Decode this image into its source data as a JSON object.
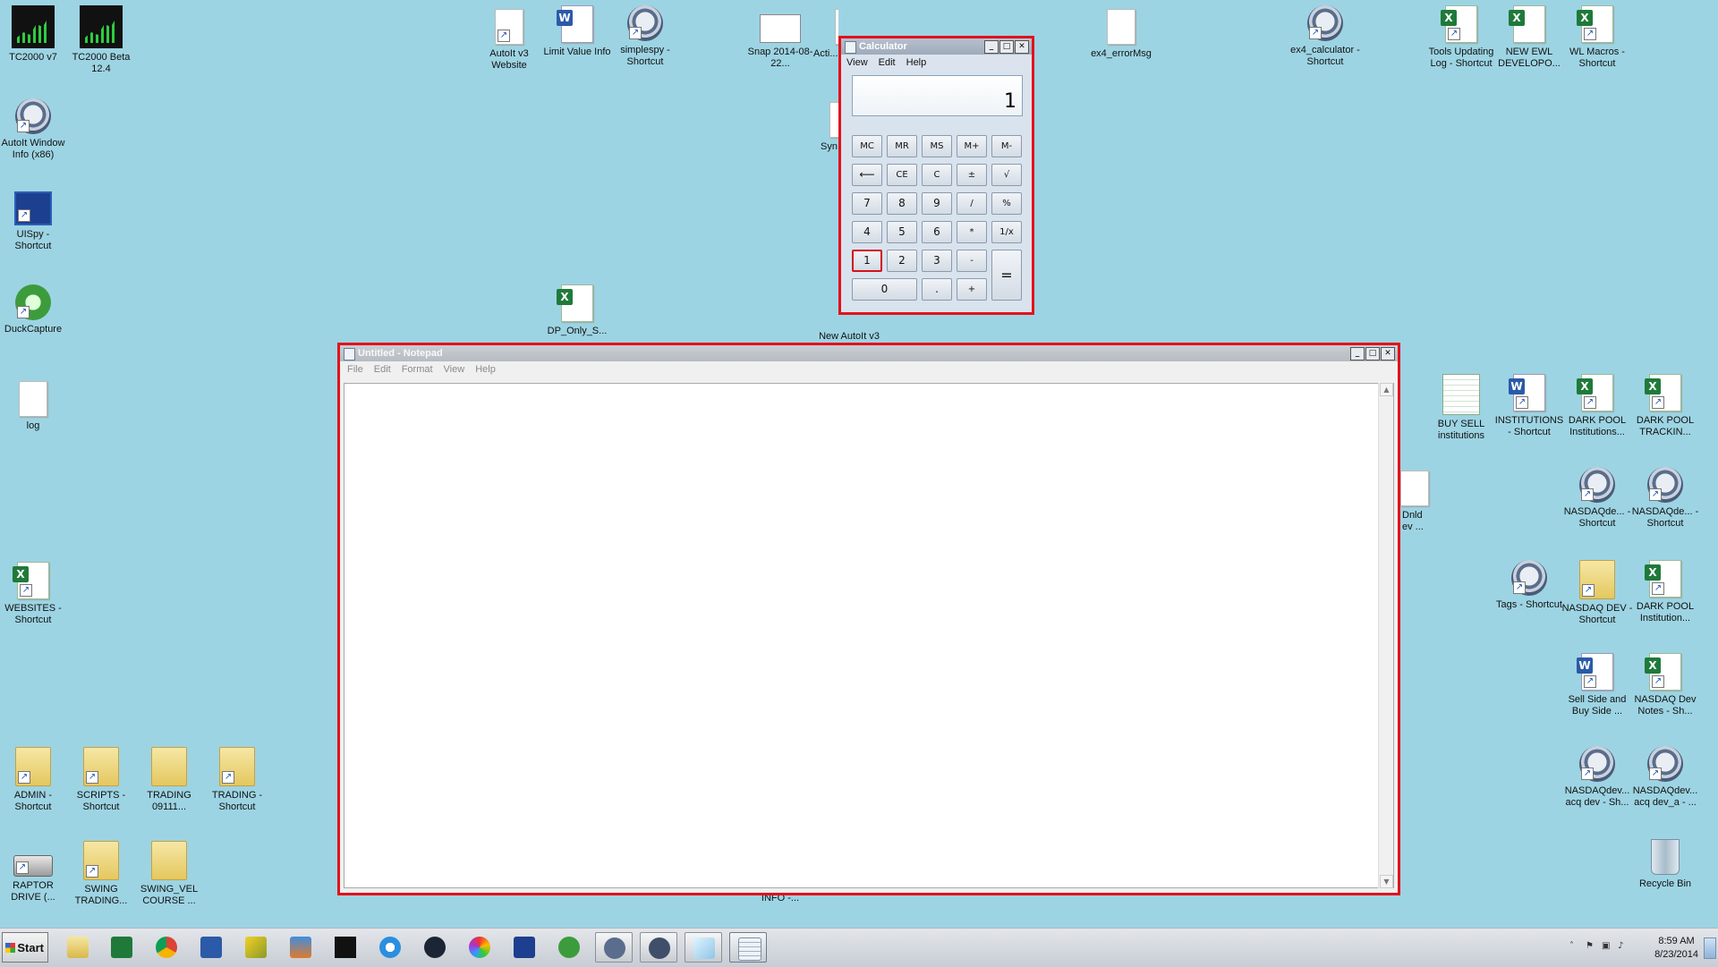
{
  "desktop": {
    "icons": [
      {
        "label": "TC2000 v7"
      },
      {
        "label": "TC2000 Beta 12.4"
      },
      {
        "label": "AutoIt Window Info (x86)"
      },
      {
        "label": "UISpy - Shortcut"
      },
      {
        "label": "DuckCapture"
      },
      {
        "label": "log"
      },
      {
        "label": "WEBSITES - Shortcut"
      },
      {
        "label": "ADMIN - Shortcut"
      },
      {
        "label": "SCRIPTS - Shortcut"
      },
      {
        "label": "TRADING 09111..."
      },
      {
        "label": "TRADING - Shortcut"
      },
      {
        "label": "RAPTOR DRIVE (..."
      },
      {
        "label": "SWING TRADING..."
      },
      {
        "label": "SWING_VEL COURSE ..."
      },
      {
        "label": "AutoIt v3 Website"
      },
      {
        "label": "Limit Value Info"
      },
      {
        "label": "simplespy - Shortcut"
      },
      {
        "label": "Snap 2014-08-22..."
      },
      {
        "label": "Acti..."
      },
      {
        "label": "Syn..."
      },
      {
        "label": "DP_Only_S..."
      },
      {
        "label": "New AutoIt v3"
      },
      {
        "label": "ex4_errorMsg"
      },
      {
        "label": "ex4_calculator - Shortcut"
      },
      {
        "label": "Tools Updating Log - Shortcut"
      },
      {
        "label": "NEW EWL DEVELOPO..."
      },
      {
        "label": "WL Macros - Shortcut"
      },
      {
        "label": "BUY SELL institutions"
      },
      {
        "label": "INSTITUTIONS - Shortcut"
      },
      {
        "label": "DARK POOL Institutions..."
      },
      {
        "label": "DARK POOL TRACKIN..."
      },
      {
        "label": "Dnld ev ..."
      },
      {
        "label": "NASDAQde... - Shortcut"
      },
      {
        "label": "NASDAQde... - Shortcut"
      },
      {
        "label": "Tags - Shortcut"
      },
      {
        "label": "NASDAQ DEV - Shortcut"
      },
      {
        "label": "DARK POOL Institution..."
      },
      {
        "label": "Sell Side and Buy Side ..."
      },
      {
        "label": "NASDAQ Dev Notes - Sh..."
      },
      {
        "label": "NASDAQdev... acq dev - Sh..."
      },
      {
        "label": "NASDAQdev... acq dev_a - ..."
      },
      {
        "label": "Recycle Bin"
      },
      {
        "label": "INFO -..."
      }
    ]
  },
  "calculator": {
    "title": "Calculator",
    "menu": [
      "View",
      "Edit",
      "Help"
    ],
    "display": "1",
    "keys": [
      "MC",
      "MR",
      "MS",
      "M+",
      "M-",
      "⟵",
      "CE",
      "C",
      "±",
      "√",
      "7",
      "8",
      "9",
      "/",
      "%",
      "4",
      "5",
      "6",
      "*",
      "1/x",
      "1",
      "2",
      "3",
      "-",
      "=",
      "0",
      ".",
      "+"
    ],
    "pressed_key": "1"
  },
  "notepad": {
    "title": "Untitled - Notepad",
    "menu": [
      "File",
      "Edit",
      "Format",
      "View",
      "Help"
    ],
    "content": ""
  },
  "window_buttons": {
    "minimize": "_",
    "maximize": "□",
    "close": "✕"
  },
  "taskbar": {
    "start_label": "Start",
    "time": "8:59 AM",
    "date": "8/23/2014",
    "apps": [
      "explorer",
      "excel",
      "chrome",
      "word",
      "tool",
      "outlook",
      "tc2000",
      "ie",
      "media",
      "picasa",
      "uispy",
      "duckcapture",
      "autoit",
      "autoit-info",
      "notepad",
      "calculator"
    ]
  },
  "colors": {
    "desktop": "#9dd4e3",
    "highlight_frame": "#e3111b"
  }
}
